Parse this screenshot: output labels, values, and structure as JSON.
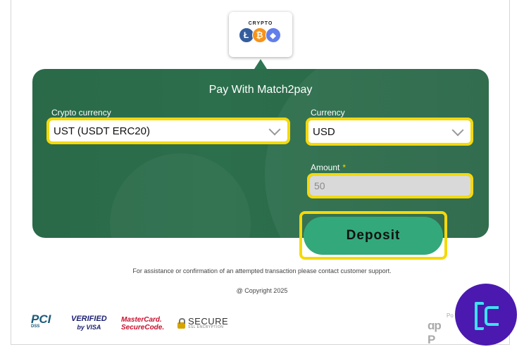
{
  "crypto_logo": {
    "label": "CRYPTO",
    "coins": [
      "Ł",
      "₿",
      "◆"
    ]
  },
  "form": {
    "title": "Pay With Match2pay",
    "crypto_currency_label": "Crypto currency",
    "crypto_currency_value": "UST (USDT ERC20)",
    "currency_label": "Currency",
    "currency_value": "USD",
    "amount_label": "Amount",
    "amount_required": "*",
    "amount_value": "50",
    "deposit_label": "Deposit"
  },
  "footer": {
    "assistance": "For assistance or confirmation of an attempted transaction please contact customer support.",
    "copyright": "@ Copyright 2025"
  },
  "logos": {
    "pci": "PCI",
    "pci_sub": "DSS",
    "vbv_1": "VERIFIED",
    "vbv_2": "by VISA",
    "mc_1": "MasterCard.",
    "mc_2": "SecureCode.",
    "secure_1": "SECURE",
    "secure_2": "SSL ENCRYPTION",
    "powered_1": "Po",
    "powered_2": "ɑp P"
  },
  "colors": {
    "panel": "#2c6f4c",
    "button": "#33a97b",
    "highlight": "#f5d90a",
    "badge": "#4b19b0"
  },
  "icons": [
    "chevron-down-icon",
    "lock-icon",
    "litecoin-icon",
    "bitcoin-icon",
    "ethereum-icon",
    "tc-badge-icon"
  ]
}
